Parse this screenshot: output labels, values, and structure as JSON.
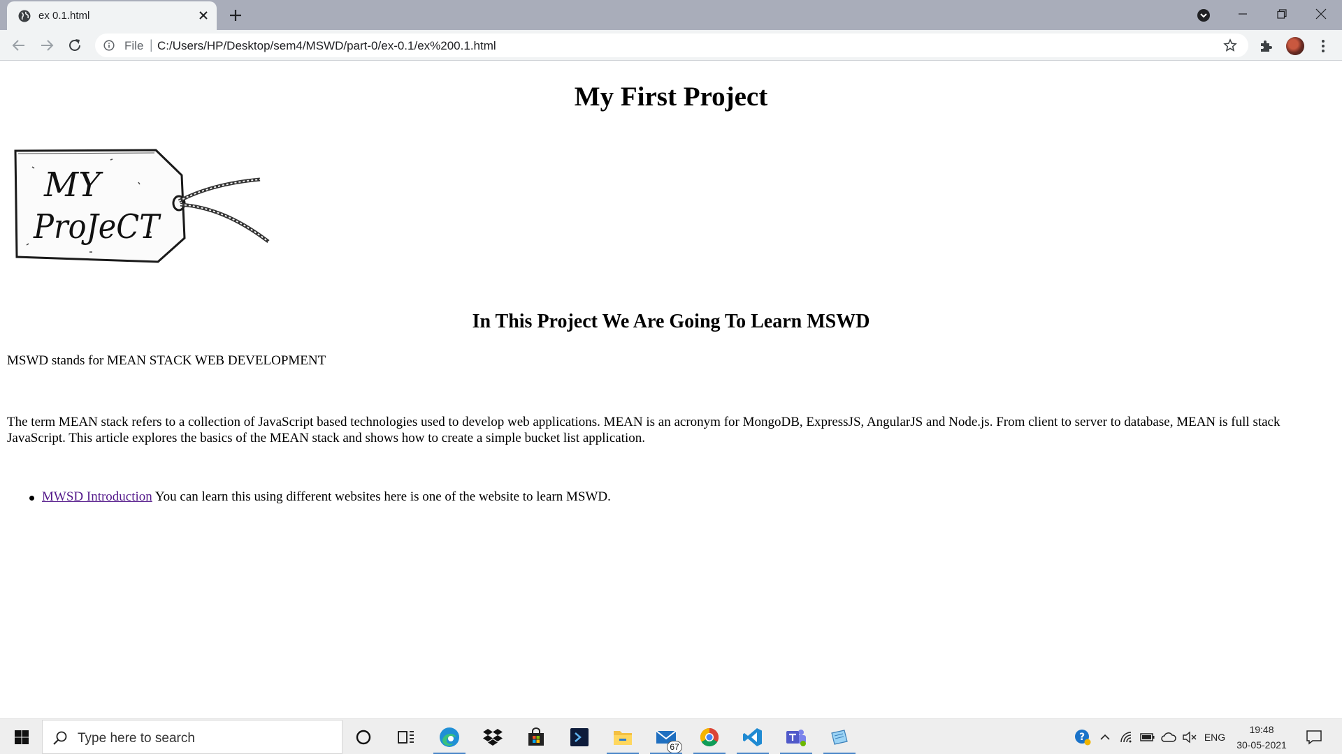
{
  "browser": {
    "tab_title": "ex 0.1.html",
    "omnibox": {
      "scheme_label": "File",
      "separator": "|",
      "url": "C:/Users/HP/Desktop/sem4/MSWD/part-0/ex-0.1/ex%200.1.html"
    }
  },
  "page": {
    "heading": "My First Project",
    "subheading": "In This Project We Are Going To Learn MSWD",
    "paragraph_1": "MSWD stands for MEAN STACK WEB DEVELOPMENT",
    "paragraph_2": "The term MEAN stack refers to a collection of JavaScript based technologies used to develop web applications. MEAN is an acronym for MongoDB, ExpressJS, AngularJS and Node.js. From client to server to database, MEAN is full stack JavaScript. This article explores the basics of the MEAN stack and shows how to create a simple bucket list application.",
    "list": [
      {
        "link_text": "MWSD Introduction",
        "text": " You can learn this using different websites here is one of the website to learn MSWD."
      }
    ],
    "image": {
      "line_1": "MY",
      "line_2": "ProJeCT"
    }
  },
  "taskbar": {
    "search_placeholder": "Type here to search",
    "mail_badge": "67",
    "language": "ENG",
    "time": "19:48",
    "date": "30-05-2021"
  },
  "colors": {
    "tab_strip": "#a9adba",
    "toolbar": "#f1f3f4",
    "link_visited": "#551a8b",
    "taskbar": "#eeeeee",
    "taskbar_active": "#4a86c8"
  }
}
